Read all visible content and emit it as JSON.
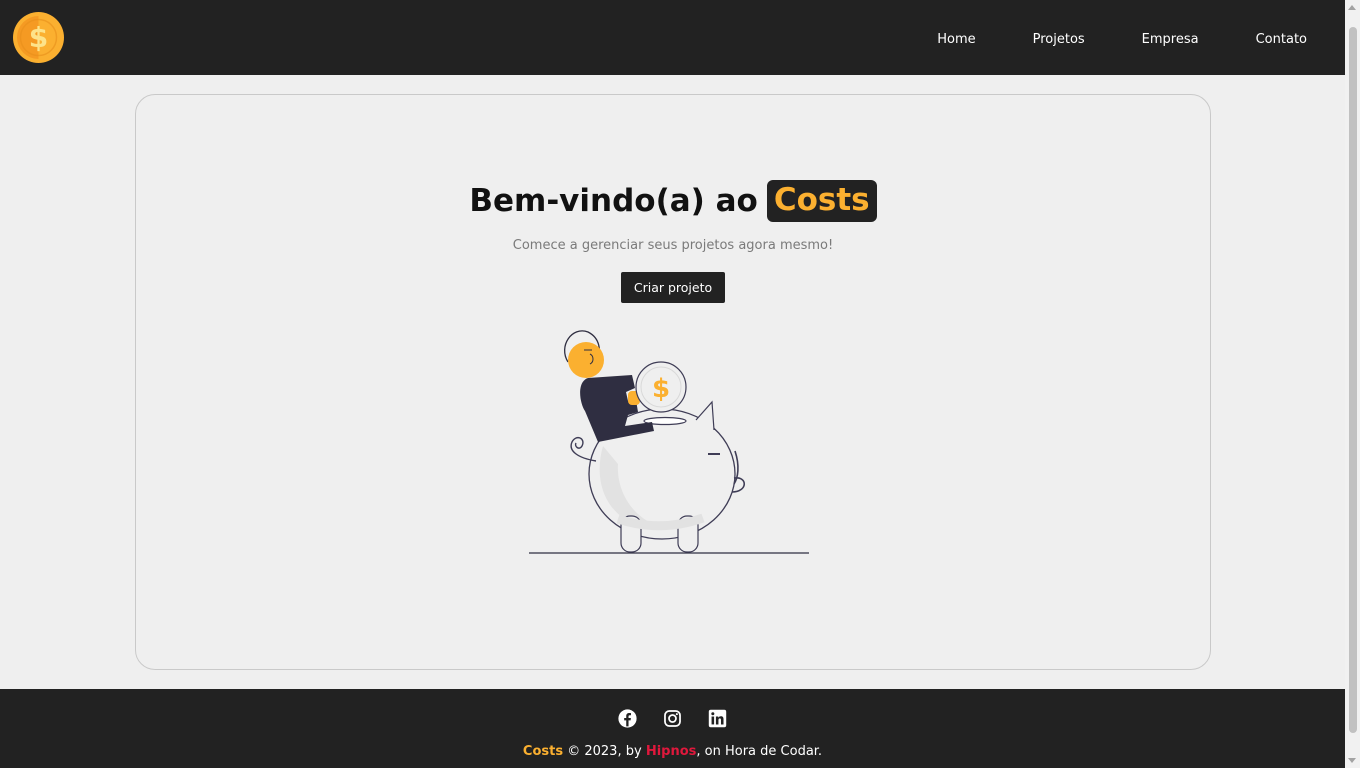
{
  "navbar": {
    "logo": {
      "icon": "coin-dollar-icon",
      "colors": {
        "outer": "#fbb030",
        "inner": "#f59a23",
        "symbol": "#fde38a"
      }
    },
    "links": [
      {
        "label": "Home"
      },
      {
        "label": "Projetos"
      },
      {
        "label": "Empresa"
      },
      {
        "label": "Contato"
      }
    ]
  },
  "hero": {
    "title_prefix": "Bem-vindo(a) ao",
    "title_brand": "Costs",
    "subtitle": "Comece a gerenciar seus projetos agora mesmo!",
    "cta_label": "Criar projeto",
    "illustration": "person-piggy-bank-savings-illustration"
  },
  "footer": {
    "social": [
      {
        "icon": "facebook-icon"
      },
      {
        "icon": "instagram-icon"
      },
      {
        "icon": "linkedin-icon"
      }
    ],
    "brand": "Costs",
    "copyright": "© 2023, by",
    "author": "Hipnos",
    "suffix": ", on Hora de Codar."
  },
  "colors": {
    "dark": "#222222",
    "accent": "#fbb030",
    "author": "#e0183c",
    "background": "#efefef"
  }
}
